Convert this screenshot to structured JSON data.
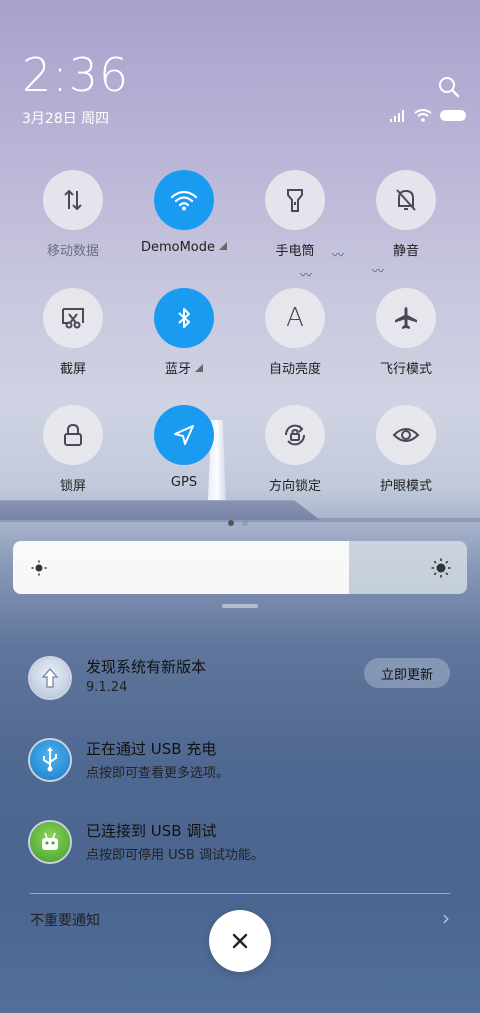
{
  "status": {
    "time": "2:36",
    "date": "3月28日 周四"
  },
  "toggles": [
    {
      "label": "移动数据",
      "icon": "mobile-data-icon",
      "on": false
    },
    {
      "label": "DemoMode",
      "icon": "wifi-icon",
      "on": true
    },
    {
      "label": "手电筒",
      "icon": "flashlight-icon",
      "on": false
    },
    {
      "label": "静音",
      "icon": "mute-bell-icon",
      "on": false
    },
    {
      "label": "截屏",
      "icon": "screenshot-icon",
      "on": false
    },
    {
      "label": "蓝牙",
      "icon": "bluetooth-icon",
      "on": true
    },
    {
      "label": "自动亮度",
      "icon": "auto-brightness-icon",
      "on": false
    },
    {
      "label": "飞行模式",
      "icon": "airplane-icon",
      "on": false
    },
    {
      "label": "锁屏",
      "icon": "lock-icon",
      "on": false
    },
    {
      "label": "GPS",
      "icon": "location-icon",
      "on": true
    },
    {
      "label": "方向锁定",
      "icon": "rotation-lock-icon",
      "on": false
    },
    {
      "label": "护眼模式",
      "icon": "eye-icon",
      "on": false
    }
  ],
  "auto_brightness_glyph": "A",
  "brightness": {
    "level": 0.74
  },
  "notifications": [
    {
      "title": "发现系统有新版本",
      "subtitle": "9.1.24",
      "action": "立即更新",
      "icon": "update-arrow-icon"
    },
    {
      "title": "正在通过 USB 充电",
      "subtitle": "点按即可查看更多选项。",
      "icon": "usb-icon"
    },
    {
      "title": "已连接到 USB 调试",
      "subtitle": "点按即可停用 USB 调试功能。",
      "icon": "android-icon"
    }
  ],
  "footer": {
    "unimportant": "不重要通知",
    "chevron": "›",
    "close": "✕"
  },
  "colors": {
    "accent": "#1a9bf2"
  }
}
